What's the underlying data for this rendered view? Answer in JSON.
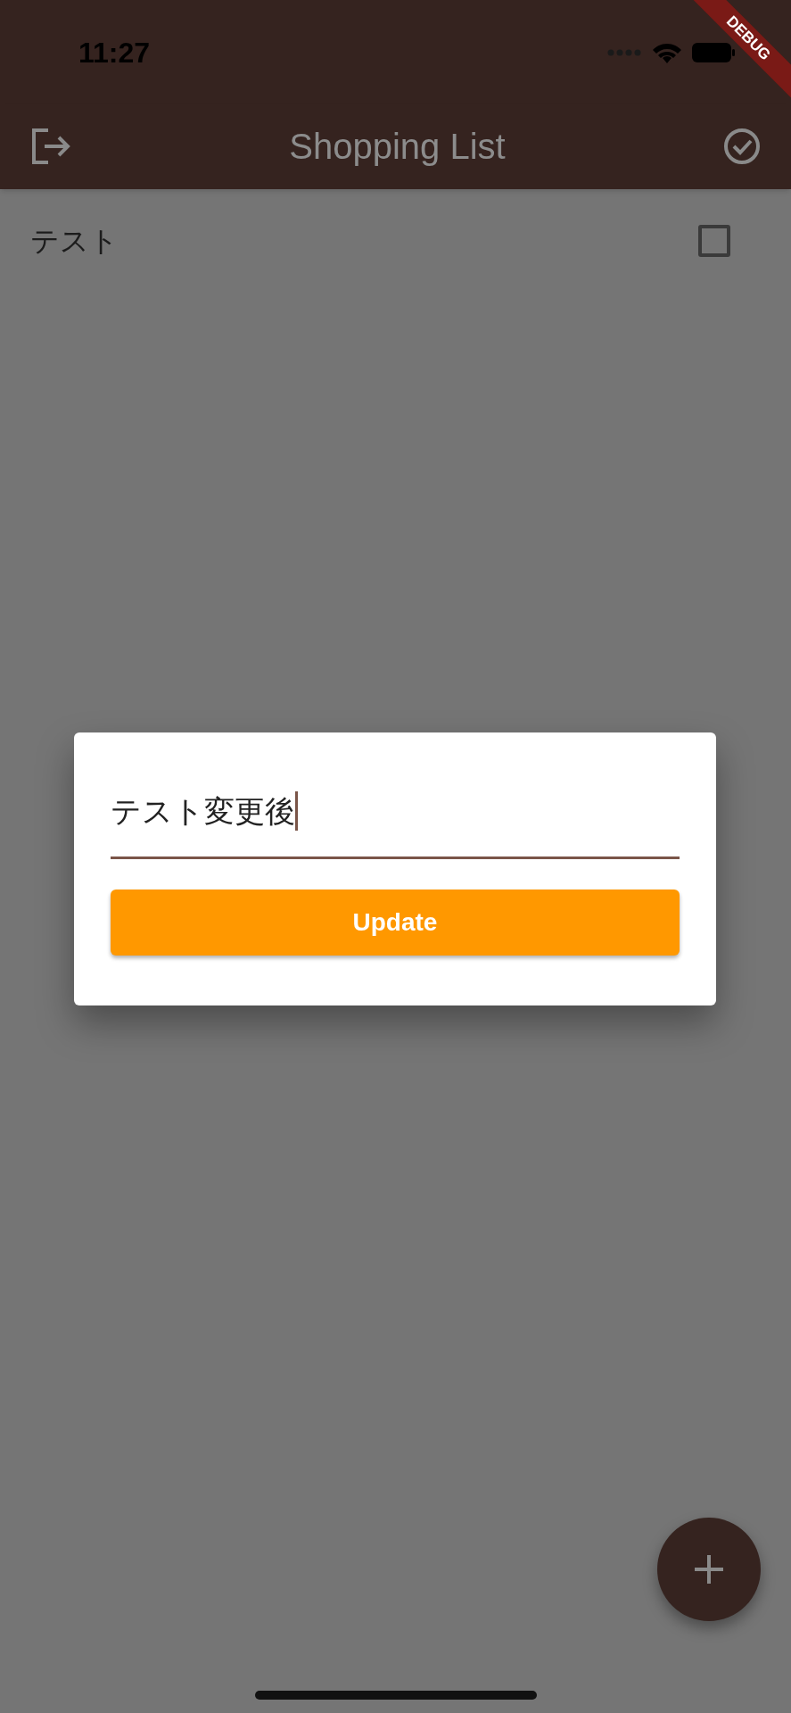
{
  "status_bar": {
    "time": "11:27"
  },
  "app_bar": {
    "title": "Shopping List"
  },
  "items": [
    {
      "name": "テスト",
      "checked": false
    }
  ],
  "dialog": {
    "field": {
      "value": "テスト変更後"
    },
    "button": "Update"
  },
  "debug_banner": "DEBUG"
}
